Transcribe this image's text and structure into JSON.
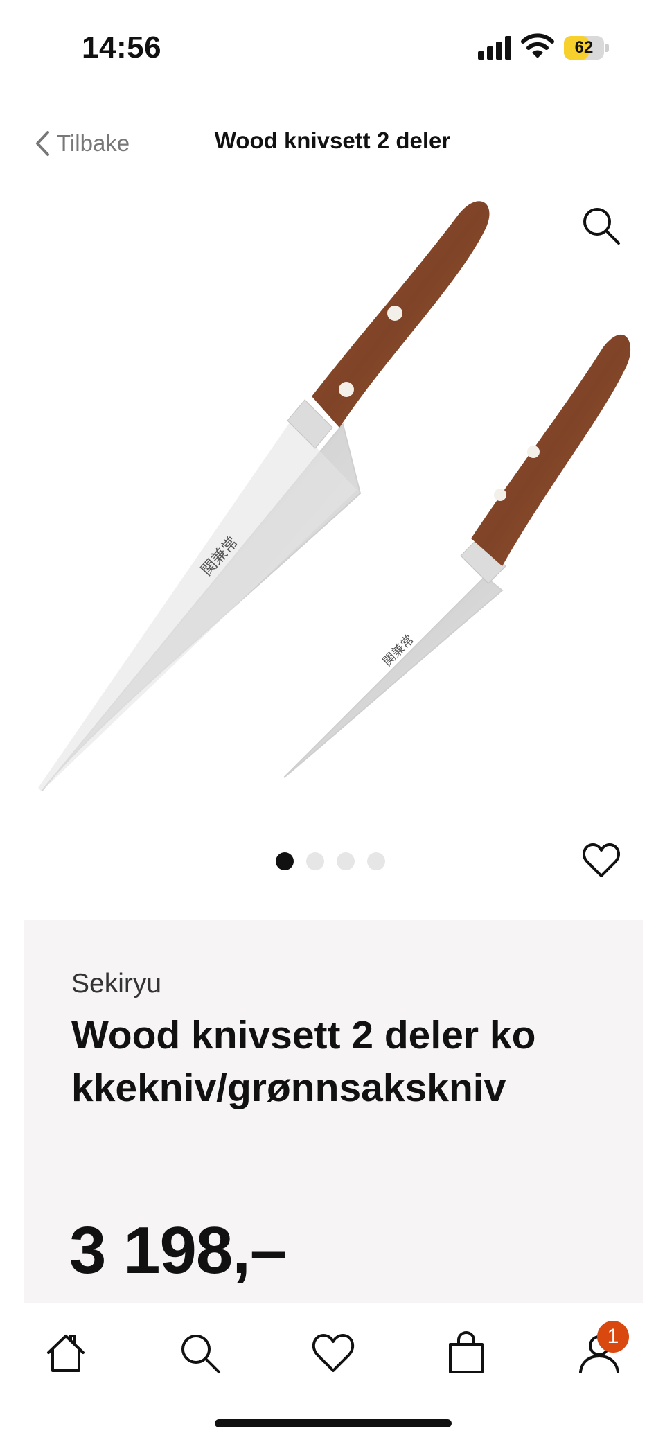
{
  "status_bar": {
    "time": "14:56",
    "battery_percent": "62",
    "battery_level": 0.62
  },
  "header": {
    "back_label": "Tilbake",
    "title": "Wood knivsett 2 deler"
  },
  "gallery": {
    "image_count": 4,
    "active_index": 0
  },
  "product": {
    "brand": "Sekiryu",
    "title": "Wood knivsett 2 deler kokkekniv/grønnsakskniv",
    "price": "3 198,–"
  },
  "tabbar": {
    "items": [
      "home-icon",
      "search-icon",
      "heart-icon",
      "bag-icon",
      "profile-icon"
    ],
    "cart_badge": "1"
  },
  "colors": {
    "panel_bg": "#f6f4f4",
    "badge": "#d9480f",
    "battery_fill": "#f7d02c",
    "handle_wood": "#8a4a2c"
  }
}
